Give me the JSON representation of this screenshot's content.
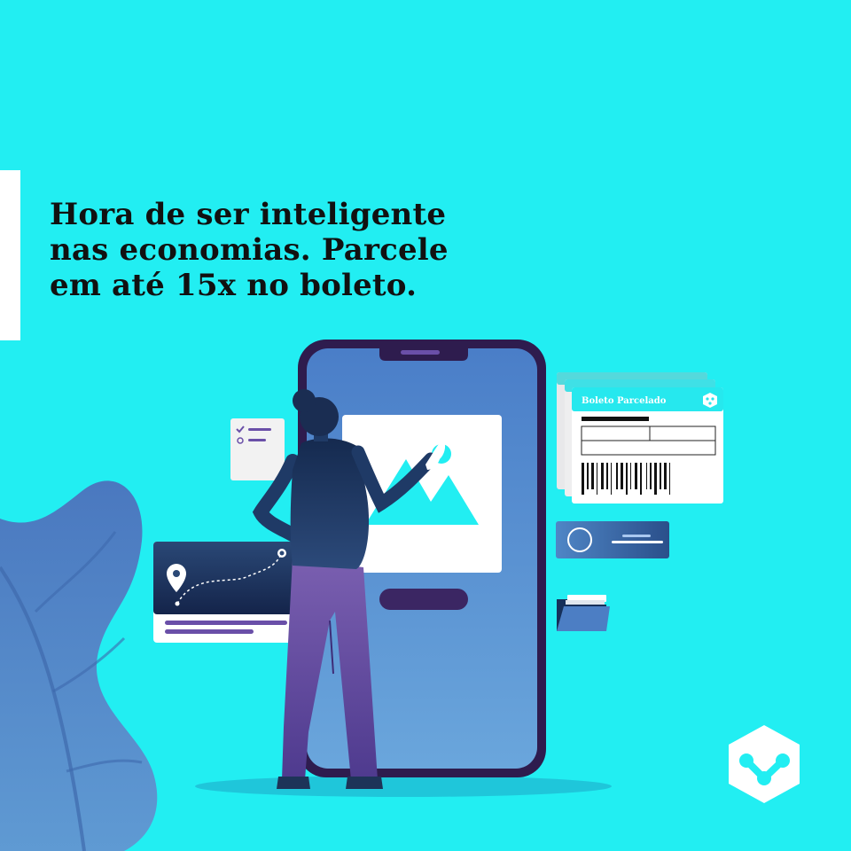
{
  "headline": {
    "line1": "Hora de ser inteligente",
    "line2": "nas economias. Parcele",
    "line3": "em até 15x no boleto."
  },
  "boleto_card": {
    "title": "Boleto Parcelado"
  },
  "colors": {
    "background": "#22eef2",
    "phone_frame": "#2e1c4e",
    "screen": "#4f83c9",
    "leaf": "#4c7ec4",
    "accent_white": "#ffffff"
  },
  "icons": [
    "map-pin-icon",
    "checklist-icon",
    "image-icon",
    "barcode-icon",
    "folder-icon",
    "brand-logo-icon"
  ]
}
